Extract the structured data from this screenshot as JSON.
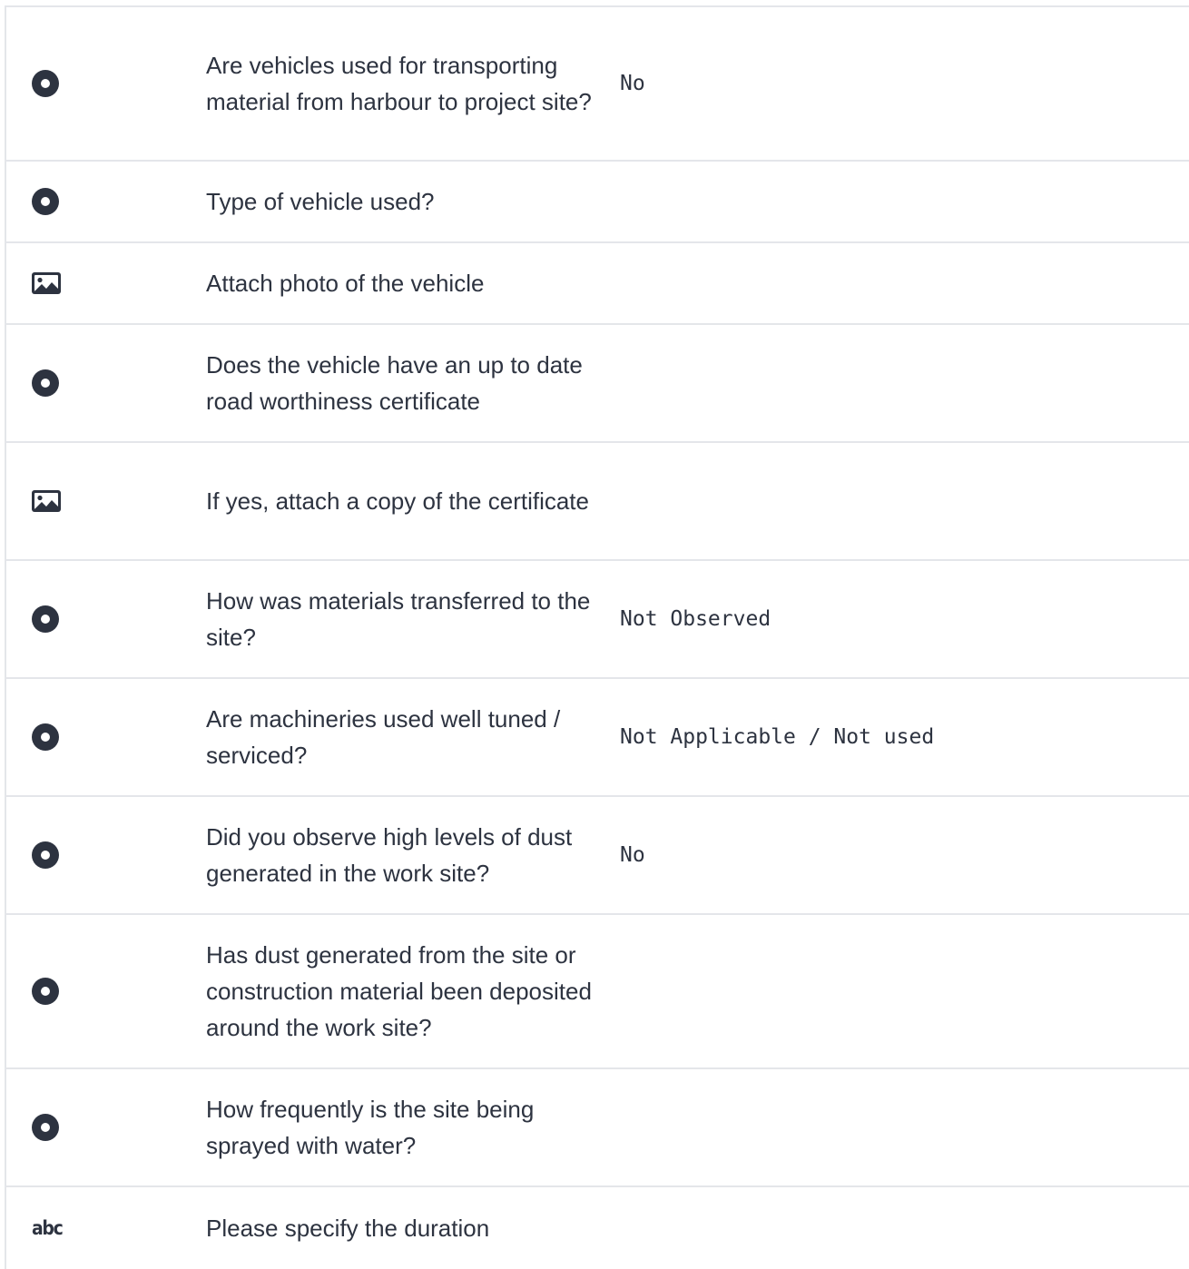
{
  "rows": [
    {
      "type": "radio",
      "icon": "radio-icon",
      "question": "Are vehicles used for transporting material from harbour to project site?",
      "answer": "No"
    },
    {
      "type": "radio",
      "icon": "radio-icon",
      "question": "Type of vehicle used?",
      "answer": ""
    },
    {
      "type": "photo",
      "icon": "image-icon",
      "question": "Attach photo of the vehicle",
      "answer": ""
    },
    {
      "type": "radio",
      "icon": "radio-icon",
      "question": "Does the vehicle have an up to date road worthiness certificate",
      "answer": ""
    },
    {
      "type": "photo",
      "icon": "image-icon",
      "question": "If yes, attach a copy of the certificate",
      "answer": ""
    },
    {
      "type": "radio",
      "icon": "radio-icon",
      "question": "How was materials transferred to the site?",
      "answer": "Not Observed"
    },
    {
      "type": "radio",
      "icon": "radio-icon",
      "question": "Are machineries used well tuned / serviced?",
      "answer": "Not Applicable / Not used"
    },
    {
      "type": "radio",
      "icon": "radio-icon",
      "question": "Did you observe high levels of dust generated in the work site?",
      "answer": "No"
    },
    {
      "type": "radio",
      "icon": "radio-icon",
      "question": "Has dust generated from the site or construction material been deposited around the work site?",
      "answer": ""
    },
    {
      "type": "radio",
      "icon": "radio-icon",
      "question": "How frequently is the site being sprayed with water?",
      "answer": ""
    },
    {
      "type": "text",
      "icon": "text-field-icon",
      "icon_text": "abc",
      "question": "Please specify the duration",
      "answer": ""
    }
  ]
}
